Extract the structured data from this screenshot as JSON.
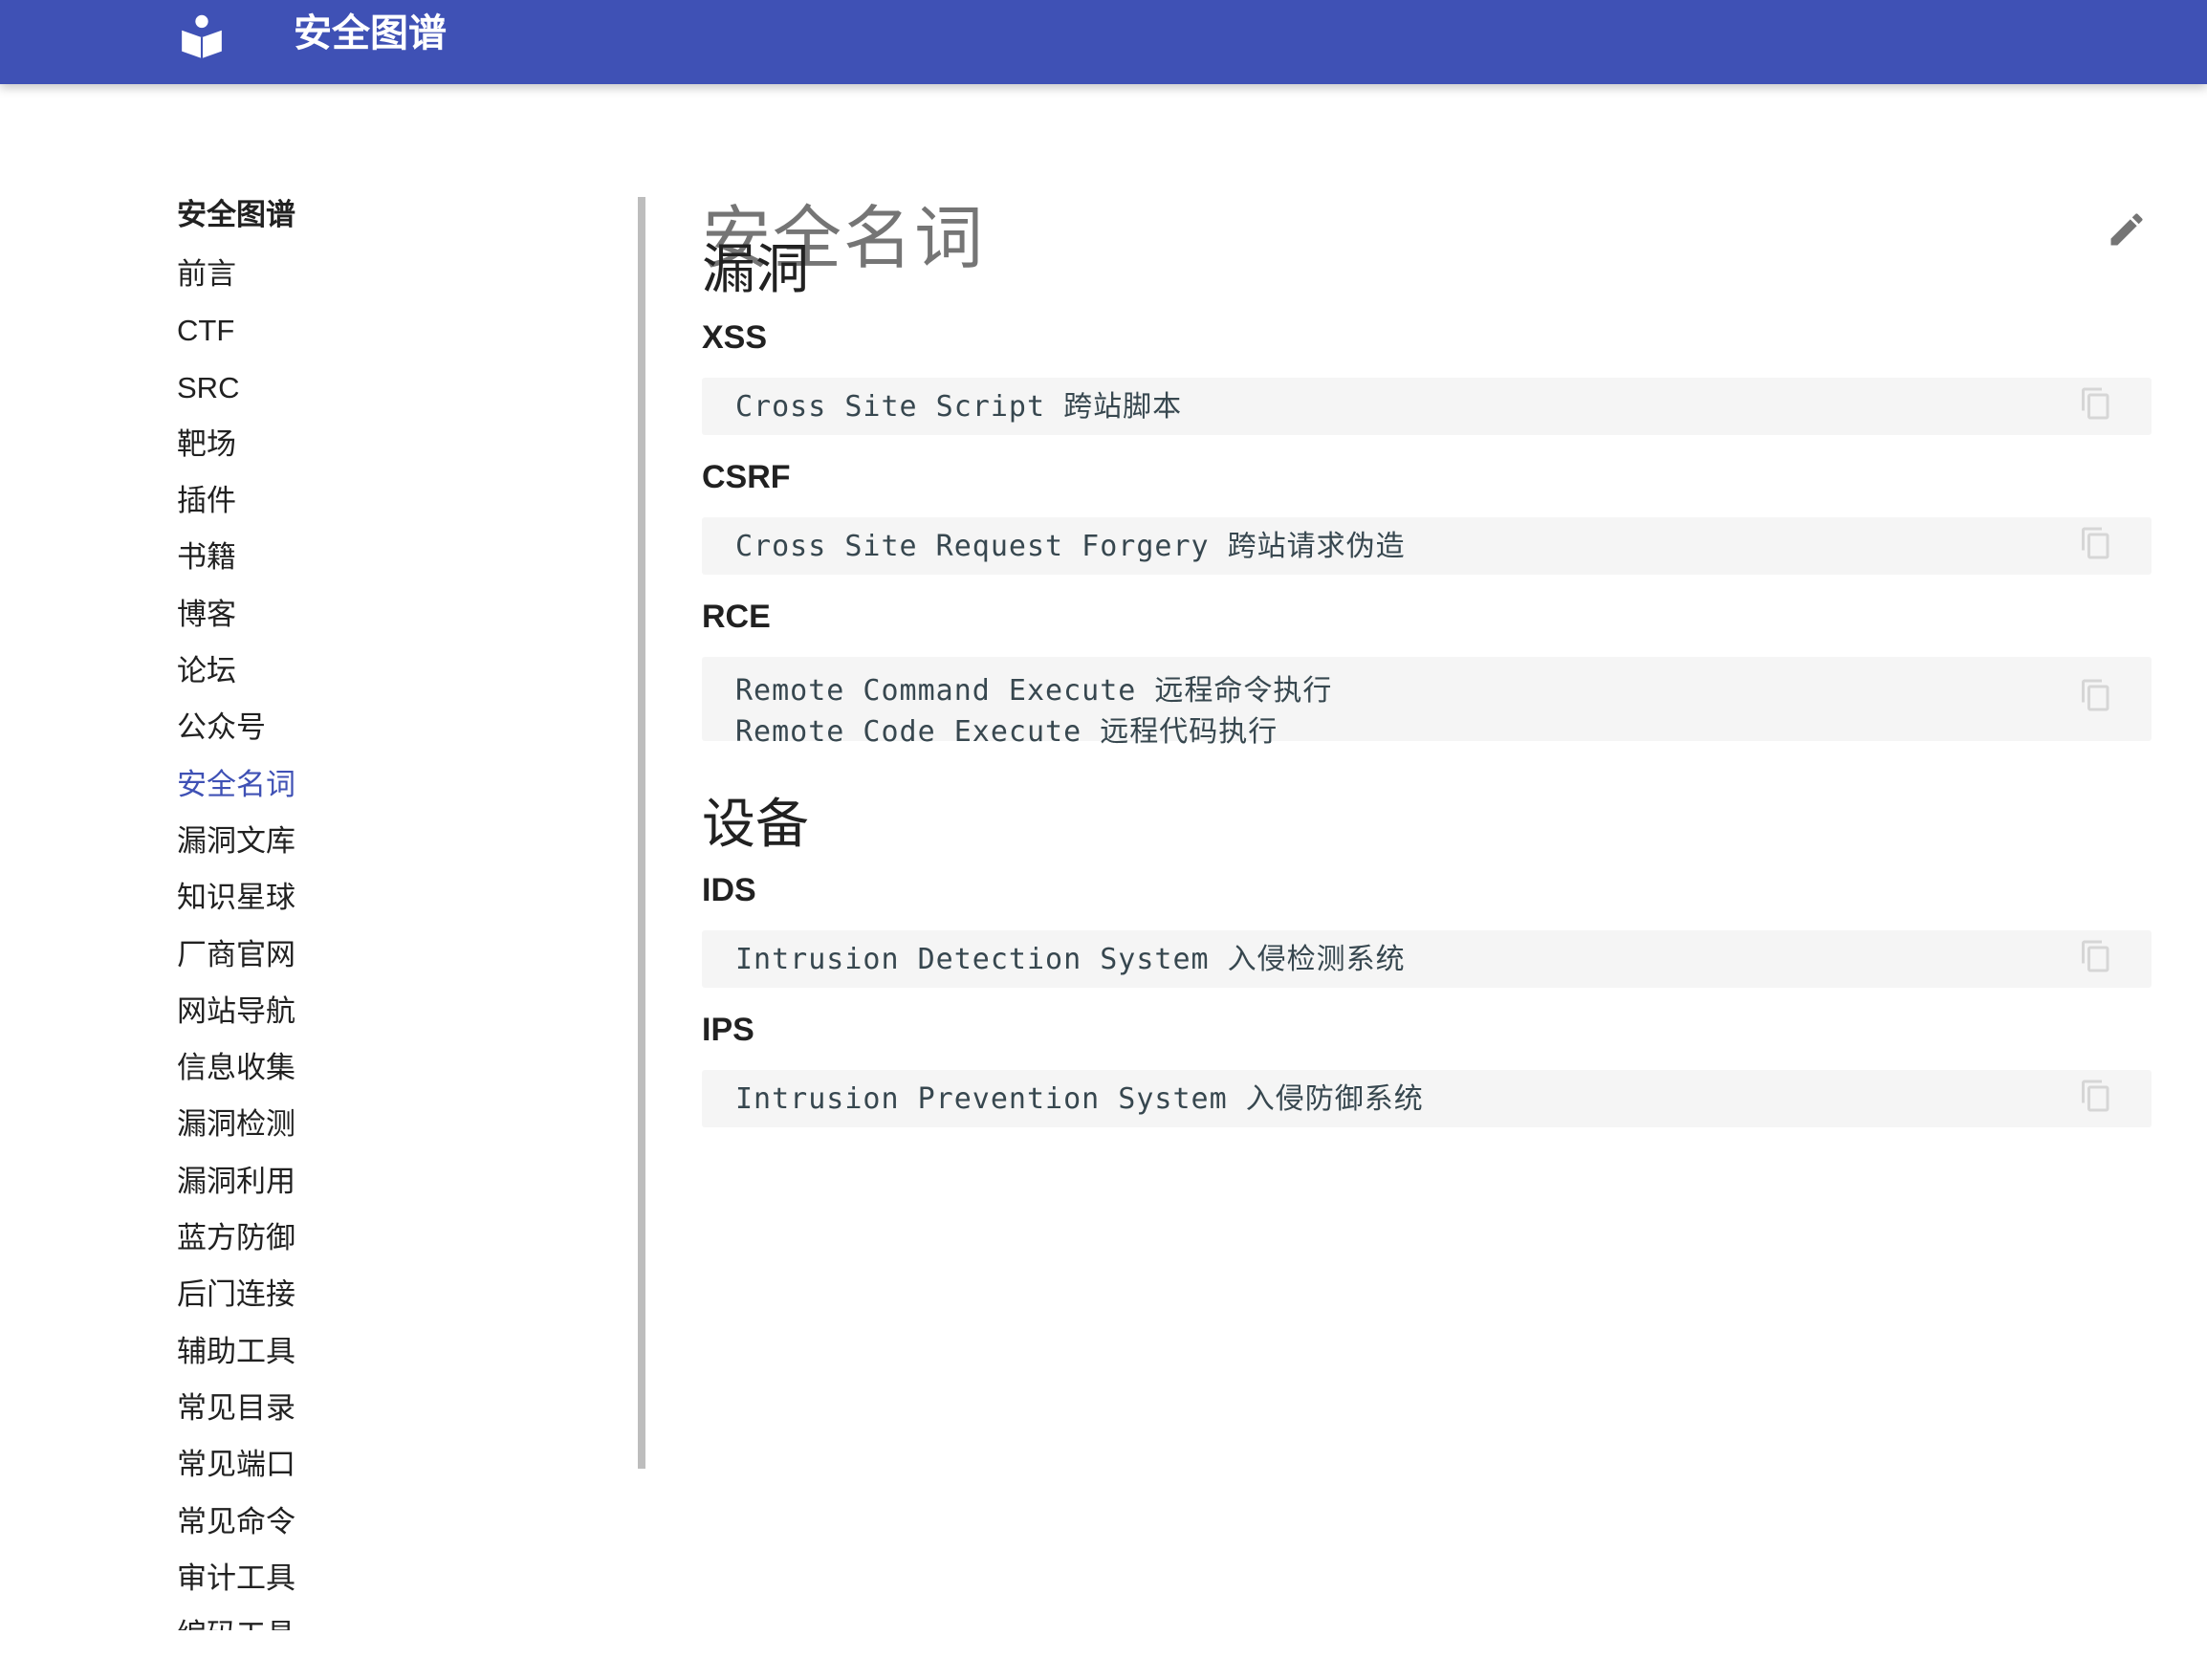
{
  "header": {
    "title": "安全图谱",
    "logo_icon": "book-icon"
  },
  "sidebar": {
    "title": "安全图谱",
    "items": [
      {
        "label": "前言"
      },
      {
        "label": "CTF"
      },
      {
        "label": "SRC"
      },
      {
        "label": "靶场"
      },
      {
        "label": "插件"
      },
      {
        "label": "书籍"
      },
      {
        "label": "博客"
      },
      {
        "label": "论坛"
      },
      {
        "label": "公众号"
      },
      {
        "label": "安全名词",
        "active": true
      },
      {
        "label": "漏洞文库"
      },
      {
        "label": "知识星球"
      },
      {
        "label": "厂商官网"
      },
      {
        "label": "网站导航"
      },
      {
        "label": "信息收集"
      },
      {
        "label": "漏洞检测"
      },
      {
        "label": "漏洞利用"
      },
      {
        "label": "蓝方防御"
      },
      {
        "label": "后门连接"
      },
      {
        "label": "辅助工具"
      },
      {
        "label": "常见目录"
      },
      {
        "label": "常见端口"
      },
      {
        "label": "常见命令"
      },
      {
        "label": "审计工具"
      },
      {
        "label": "编码工具"
      }
    ]
  },
  "page": {
    "title": "安全名词",
    "sections": [
      {
        "heading": "漏洞",
        "terms": [
          {
            "name": "XSS",
            "lines": [
              "Cross Site Script 跨站脚本"
            ]
          },
          {
            "name": "CSRF",
            "lines": [
              "Cross Site Request Forgery 跨站请求伪造"
            ]
          },
          {
            "name": "RCE",
            "lines": [
              "Remote Command Execute 远程命令执行",
              "Remote Code Execute 远程代码执行"
            ]
          }
        ]
      },
      {
        "heading": "设备",
        "terms": [
          {
            "name": "IDS",
            "lines": [
              "Intrusion Detection System 入侵检测系统"
            ]
          },
          {
            "name": "IPS",
            "lines": [
              "Intrusion Prevention System 入侵防御系统"
            ]
          }
        ]
      }
    ]
  },
  "icons": {
    "edit": "pencil-icon",
    "copy": "copy-icon"
  },
  "colors": {
    "primary": "#3f51b5",
    "code_bg": "#f5f5f5",
    "muted": "#757575"
  }
}
